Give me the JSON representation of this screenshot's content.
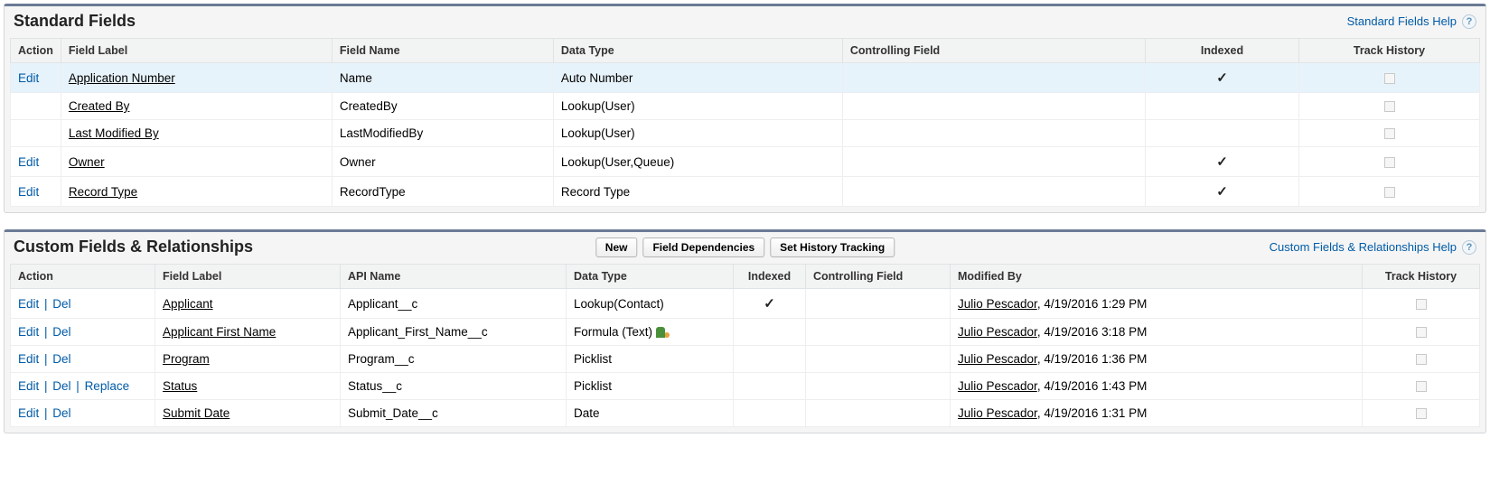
{
  "standard": {
    "title": "Standard Fields",
    "help_link": "Standard Fields Help",
    "columns": {
      "action": "Action",
      "field_label": "Field Label",
      "field_name": "Field Name",
      "data_type": "Data Type",
      "controlling_field": "Controlling Field",
      "indexed": "Indexed",
      "track_history": "Track History"
    },
    "action_edit": "Edit",
    "rows": [
      {
        "highlight": true,
        "edit": true,
        "label": "Application Number",
        "name": "Name",
        "type": "Auto Number",
        "indexed": true,
        "track_chk": true
      },
      {
        "highlight": false,
        "edit": false,
        "label": "Created By",
        "name": "CreatedBy",
        "type": "Lookup(User)",
        "indexed": false,
        "track_chk": true
      },
      {
        "highlight": false,
        "edit": false,
        "label": "Last Modified By",
        "name": "LastModifiedBy",
        "type": "Lookup(User)",
        "indexed": false,
        "track_chk": true
      },
      {
        "highlight": false,
        "edit": true,
        "label": "Owner",
        "name": "Owner",
        "type": "Lookup(User,Queue)",
        "indexed": true,
        "track_chk": true
      },
      {
        "highlight": false,
        "edit": true,
        "label": "Record Type",
        "name": "RecordType",
        "type": "Record Type",
        "indexed": true,
        "track_chk": true
      }
    ]
  },
  "custom": {
    "title": "Custom Fields & Relationships",
    "help_link": "Custom Fields & Relationships Help",
    "buttons": {
      "new": "New",
      "deps": "Field Dependencies",
      "history": "Set History Tracking"
    },
    "columns": {
      "action": "Action",
      "field_label": "Field Label",
      "api_name": "API Name",
      "data_type": "Data Type",
      "indexed": "Indexed",
      "controlling_field": "Controlling Field",
      "modified_by": "Modified By",
      "track_history": "Track History"
    },
    "action_edit": "Edit",
    "action_del": "Del",
    "action_replace": "Replace",
    "sep": "|",
    "rows": [
      {
        "label": "Applicant",
        "api": "Applicant__c",
        "type": "Lookup(Contact)",
        "formula_icon": false,
        "indexed": true,
        "mod_by": "Julio Pescador",
        "mod_date": ", 4/19/2016 1:29 PM",
        "replace": false
      },
      {
        "label": "Applicant First Name",
        "api": "Applicant_First_Name__c",
        "type": "Formula (Text)",
        "formula_icon": true,
        "indexed": false,
        "mod_by": "Julio Pescador",
        "mod_date": ", 4/19/2016 3:18 PM",
        "replace": false
      },
      {
        "label": "Program",
        "api": "Program__c",
        "type": "Picklist",
        "formula_icon": false,
        "indexed": false,
        "mod_by": "Julio Pescador",
        "mod_date": ", 4/19/2016 1:36 PM",
        "replace": false
      },
      {
        "label": "Status",
        "api": "Status__c",
        "type": "Picklist",
        "formula_icon": false,
        "indexed": false,
        "mod_by": "Julio Pescador",
        "mod_date": ", 4/19/2016 1:43 PM",
        "replace": true
      },
      {
        "label": "Submit Date",
        "api": "Submit_Date__c",
        "type": "Date",
        "formula_icon": false,
        "indexed": false,
        "mod_by": "Julio Pescador",
        "mod_date": ", 4/19/2016 1:31 PM",
        "replace": false
      }
    ]
  }
}
